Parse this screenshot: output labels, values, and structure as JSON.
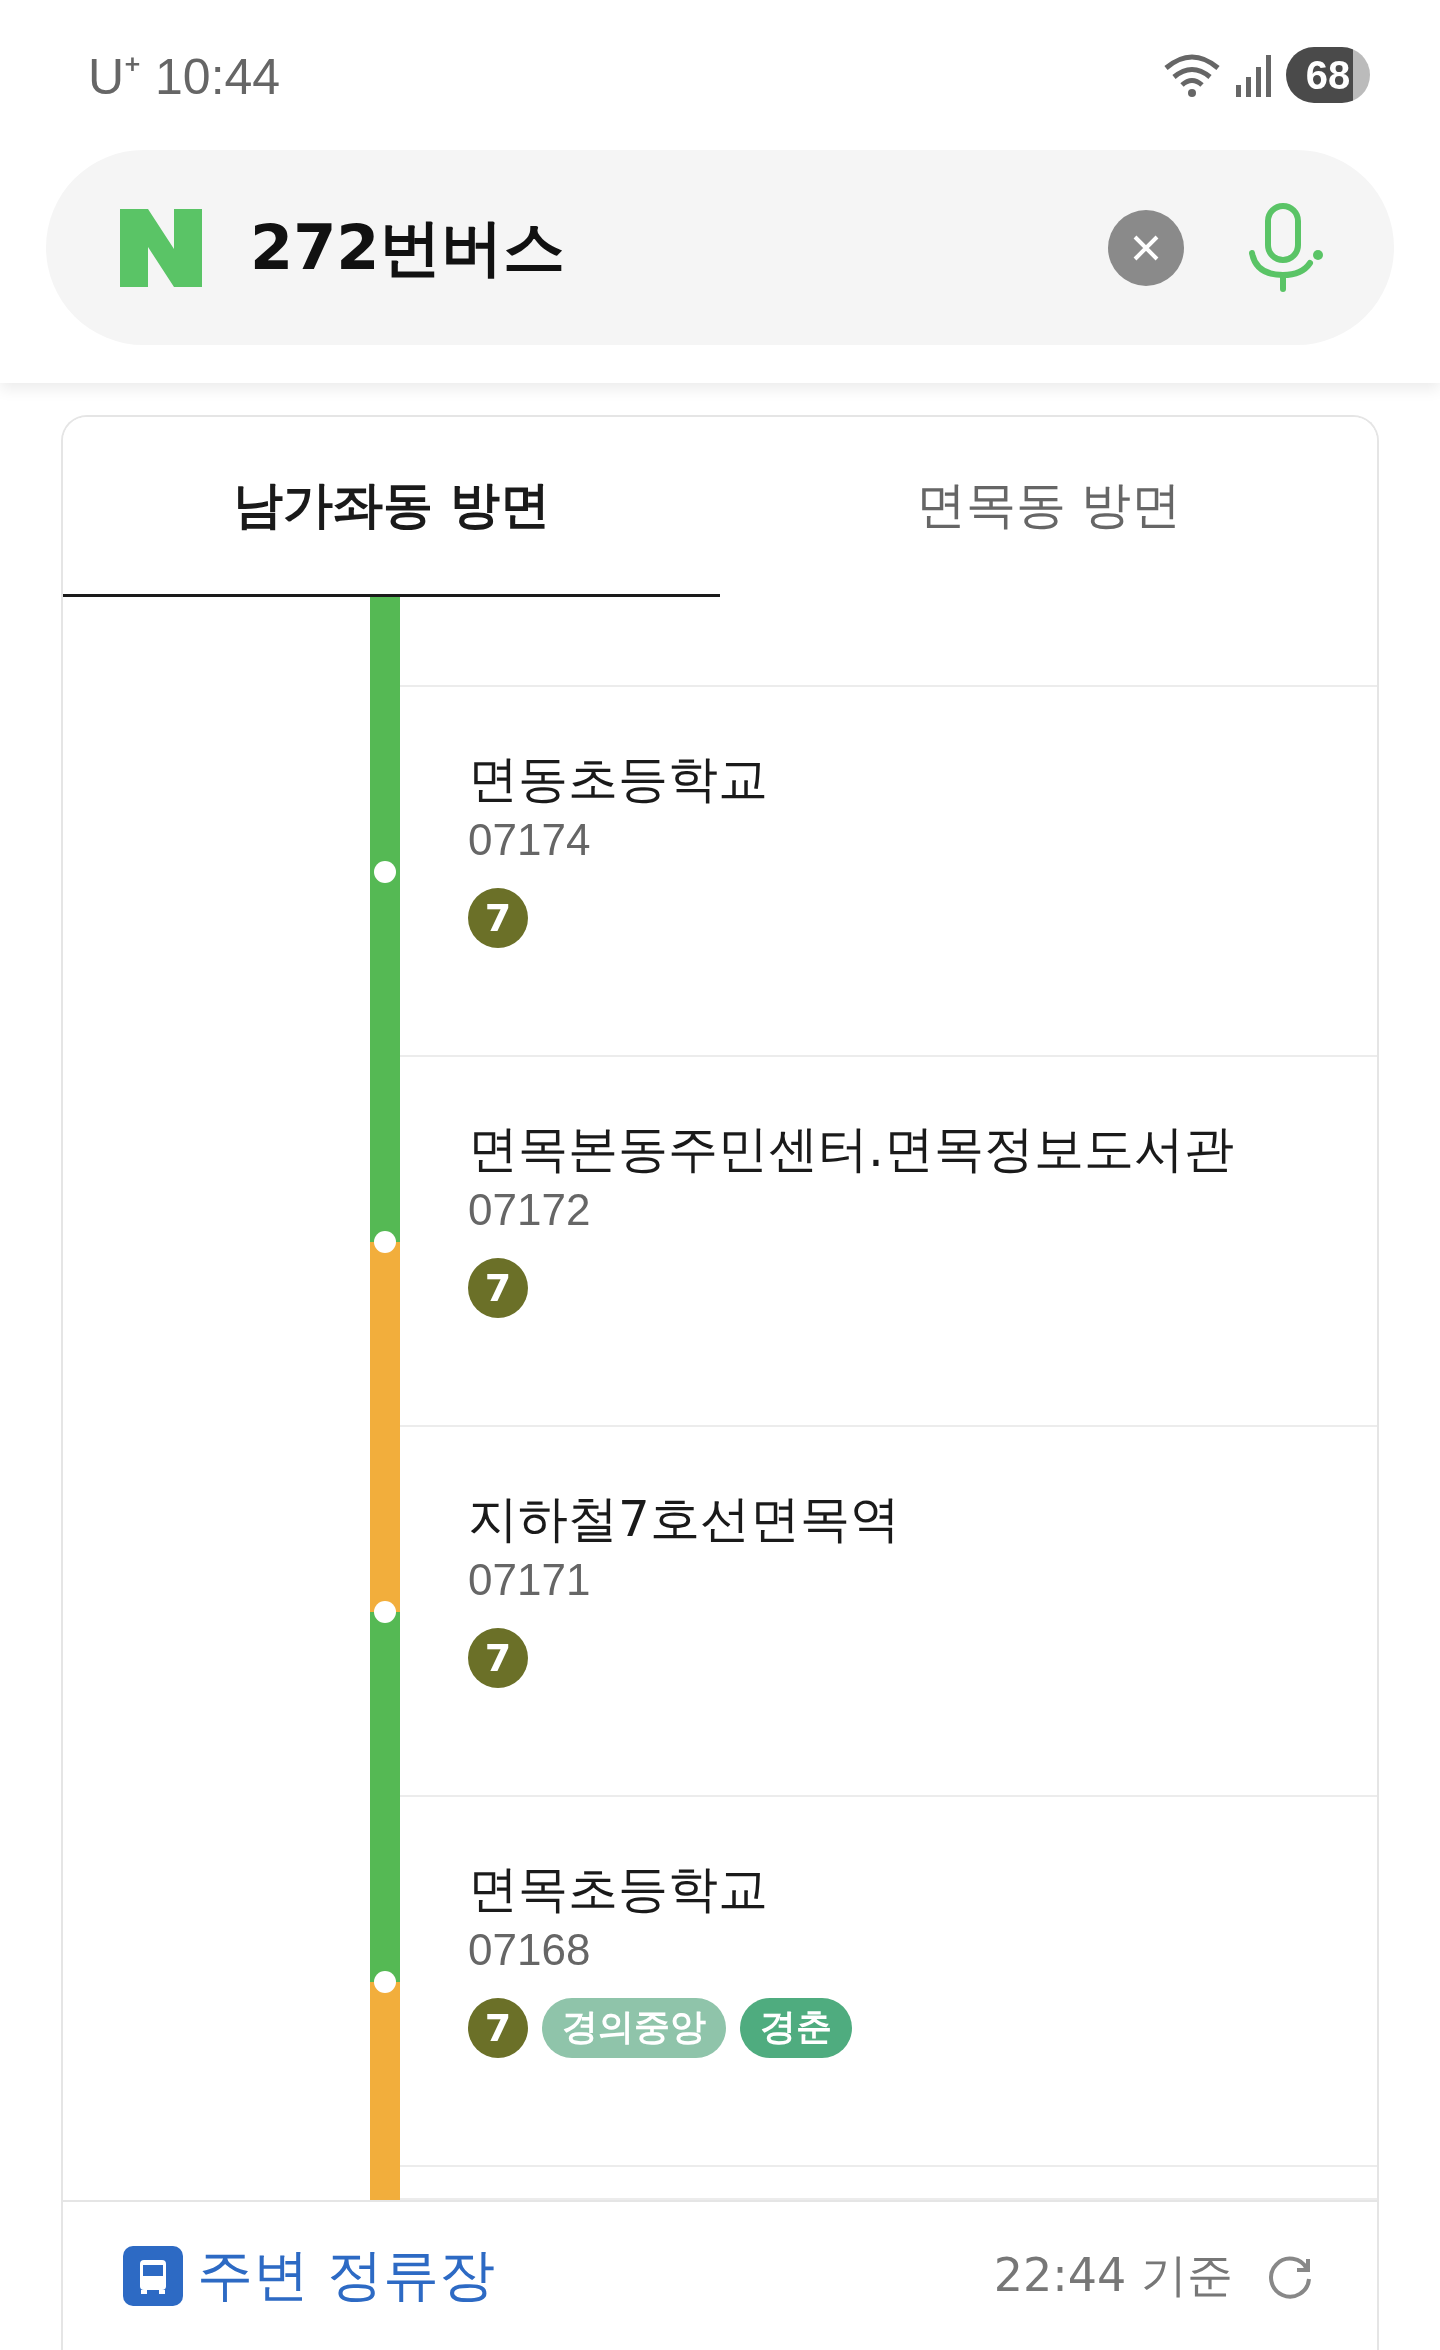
{
  "status_bar": {
    "carrier": "U⁺",
    "time": "10:44",
    "battery": "68"
  },
  "search": {
    "value": "272번버스"
  },
  "tabs": [
    {
      "label": "남가좌동 방면",
      "selected": true
    },
    {
      "label": "면목동 방면",
      "selected": false
    }
  ],
  "route": {
    "segments": [
      {
        "color": "#55b954"
      },
      {
        "color": "#55b954"
      },
      {
        "color": "#f2ae3c"
      },
      {
        "color": "#55b954"
      },
      {
        "color": "#f2ae3c"
      }
    ],
    "stops": [
      {
        "name": "면동초등학교",
        "code": "07174",
        "lines": [
          {
            "label": "7",
            "kind": "circle",
            "color": "#6b7028"
          }
        ]
      },
      {
        "name": "면목본동주민센터.면목정보도서관",
        "code": "07172",
        "lines": [
          {
            "label": "7",
            "kind": "circle",
            "color": "#6b7028"
          }
        ]
      },
      {
        "name": "지하철7호선면목역",
        "code": "07171",
        "lines": [
          {
            "label": "7",
            "kind": "circle",
            "color": "#6b7028"
          }
        ]
      },
      {
        "name": "면목초등학교",
        "code": "07168",
        "lines": [
          {
            "label": "7",
            "kind": "circle",
            "color": "#6b7028"
          },
          {
            "label": "경의중앙",
            "kind": "pill",
            "color": "#8fc4aa"
          },
          {
            "label": "경춘",
            "kind": "pill",
            "color": "#4fac7f"
          }
        ]
      }
    ]
  },
  "footer": {
    "nearby": "주변 정류장",
    "updated": "22:44 기준"
  }
}
